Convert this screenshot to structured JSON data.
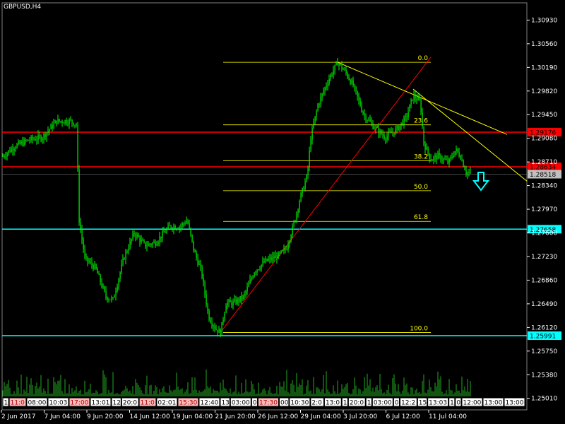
{
  "chart_data": {
    "type": "candlestick",
    "title": "GBPUSD,H4",
    "colors": {
      "background": "#000000",
      "candle": "#00ff00",
      "volume": "#22aa22",
      "axis_text": "#ffffff",
      "red_line": "#ff0000",
      "cyan_line": "#00ffff",
      "fib": "#ffff00",
      "trend": "#ffff00",
      "arrow": "#00ffff"
    },
    "y_axis": {
      "min": 1.2483,
      "max": 1.312,
      "ticks": [
        "1.30930",
        "1.30560",
        "1.30190",
        "1.29820",
        "1.29450",
        "1.29080",
        "1.28710",
        "1.28340",
        "1.27970",
        "1.27600",
        "1.27230",
        "1.26860",
        "1.26490",
        "1.26120",
        "1.25750",
        "1.25380",
        "1.25010"
      ]
    },
    "x_axis": {
      "labels": [
        "2 Jun 2017",
        "7 Jun 04:00",
        "9 Jun 20:00",
        "14 Jun 12:00",
        "19 Jun 04:00",
        "21 Jun 20:00",
        "26 Jun 12:00",
        "29 Jun 04:00",
        "3 Jul 20:00",
        "6 Jul 12:00",
        "11 Jul 04:00"
      ]
    },
    "price_levels": [
      {
        "price": 1.29176,
        "label": "1.29176",
        "color": "#ff0000"
      },
      {
        "price": 1.28634,
        "label": "1.28634",
        "color": "#ff0000"
      },
      {
        "price": 1.28518,
        "label": "1.28518",
        "color": "#c0c0c0"
      },
      {
        "price": 1.27658,
        "label": "1.27658",
        "color": "#00ffff"
      },
      {
        "price": 1.25991,
        "label": "1.25991",
        "color": "#00ffff"
      }
    ],
    "fibonacci": [
      {
        "level": "0.0",
        "price": 1.3027
      },
      {
        "level": "23.6",
        "price": 1.2929
      },
      {
        "level": "38.2",
        "price": 1.2873
      },
      {
        "level": "50.0",
        "price": 1.2826
      },
      {
        "level": "61.8",
        "price": 1.2778
      },
      {
        "level": "100.0",
        "price": 1.2604
      }
    ],
    "trendlines": [
      {
        "from_price": 1.2604,
        "to_price": 1.3027,
        "color": "#ff0000"
      },
      {
        "from_price": 1.3027,
        "to_price": 1.2914,
        "color": "#ffff00"
      },
      {
        "from_price": 1.2985,
        "to_price": 1.2841,
        "color": "#ffff00"
      }
    ],
    "highlighted_time_labels": [
      "11:0",
      "17:00",
      "15:30",
      "17:30"
    ],
    "time_labels": [
      "1",
      "11:0",
      "08:00",
      "10:03",
      "17:00",
      "13:01",
      "12",
      "20:0",
      "11:0",
      "02:01",
      "15:30",
      "12:40",
      "13",
      "03:00",
      "0",
      "17:30",
      "00",
      "10:30",
      "2:0",
      "13:0",
      "1",
      "20:0",
      "1",
      "03:00",
      "0",
      "12:2",
      "15",
      "13:03",
      "1",
      "0",
      "12:00",
      "13:00",
      "13:00"
    ]
  }
}
